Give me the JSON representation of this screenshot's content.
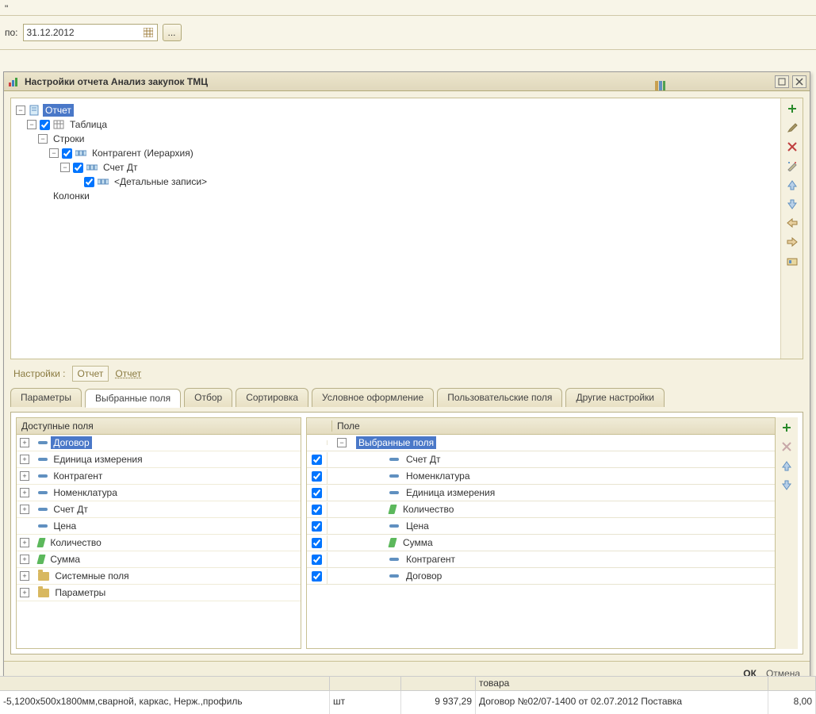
{
  "topbar_text": "\"",
  "date": {
    "label": "по:",
    "value": "31.12.2012",
    "dots": "..."
  },
  "dialog": {
    "title": "Настройки отчета  Анализ закупок ТМЦ",
    "tree": {
      "root": "Отчет",
      "table": "Таблица",
      "rows": "Строки",
      "n1": "Контрагент (Иерархия)",
      "n2": "Счет Дт",
      "n3": "<Детальные записи>",
      "cols": "Колонки"
    },
    "settings_label": "Настройки :",
    "settings_active": "Отчет",
    "settings_link": "Отчет",
    "tabs": {
      "t1": "Параметры",
      "t2": "Выбранные поля",
      "t3": "Отбор",
      "t4": "Сортировка",
      "t5": "Условное оформление",
      "t6": "Пользовательские поля",
      "t7": "Другие настройки"
    },
    "avail_head": "Доступные поля",
    "avail": [
      {
        "label": "Договор",
        "exp": true,
        "icon": "dash",
        "sel": true
      },
      {
        "label": "Единица измерения",
        "exp": true,
        "icon": "dash"
      },
      {
        "label": "Контрагент",
        "exp": true,
        "icon": "dash"
      },
      {
        "label": "Номенклатура",
        "exp": true,
        "icon": "dash"
      },
      {
        "label": "Счет Дт",
        "exp": true,
        "icon": "dash"
      },
      {
        "label": "Цена",
        "exp": false,
        "icon": "dash"
      },
      {
        "label": "Количество",
        "exp": true,
        "icon": "green"
      },
      {
        "label": "Сумма",
        "exp": true,
        "icon": "green"
      },
      {
        "label": "Системные поля",
        "exp": true,
        "icon": "folder"
      },
      {
        "label": "Параметры",
        "exp": true,
        "icon": "folder"
      }
    ],
    "sel_head": "Поле",
    "sel_group": "Выбранные поля",
    "sel": [
      {
        "label": "Счет Дт",
        "icon": "dash"
      },
      {
        "label": "Номенклатура",
        "icon": "dash"
      },
      {
        "label": "Единица измерения",
        "icon": "dash"
      },
      {
        "label": "Количество",
        "icon": "green"
      },
      {
        "label": "Цена",
        "icon": "dash"
      },
      {
        "label": "Сумма",
        "icon": "green"
      },
      {
        "label": "Контрагент",
        "icon": "dash"
      },
      {
        "label": "Договор",
        "icon": "dash"
      }
    ],
    "ok": "ОК",
    "cancel": "Отмена"
  },
  "status_head": {
    "col": "товара"
  },
  "status": {
    "desc": "-5,1200х500х1800мм,сварной, каркас, Нерж.,профиль",
    "unit": "шт",
    "price": "9 937,29",
    "contract": "Договор №02/07-1400 от 02.07.2012 Поставка",
    "qty": "8,00"
  }
}
